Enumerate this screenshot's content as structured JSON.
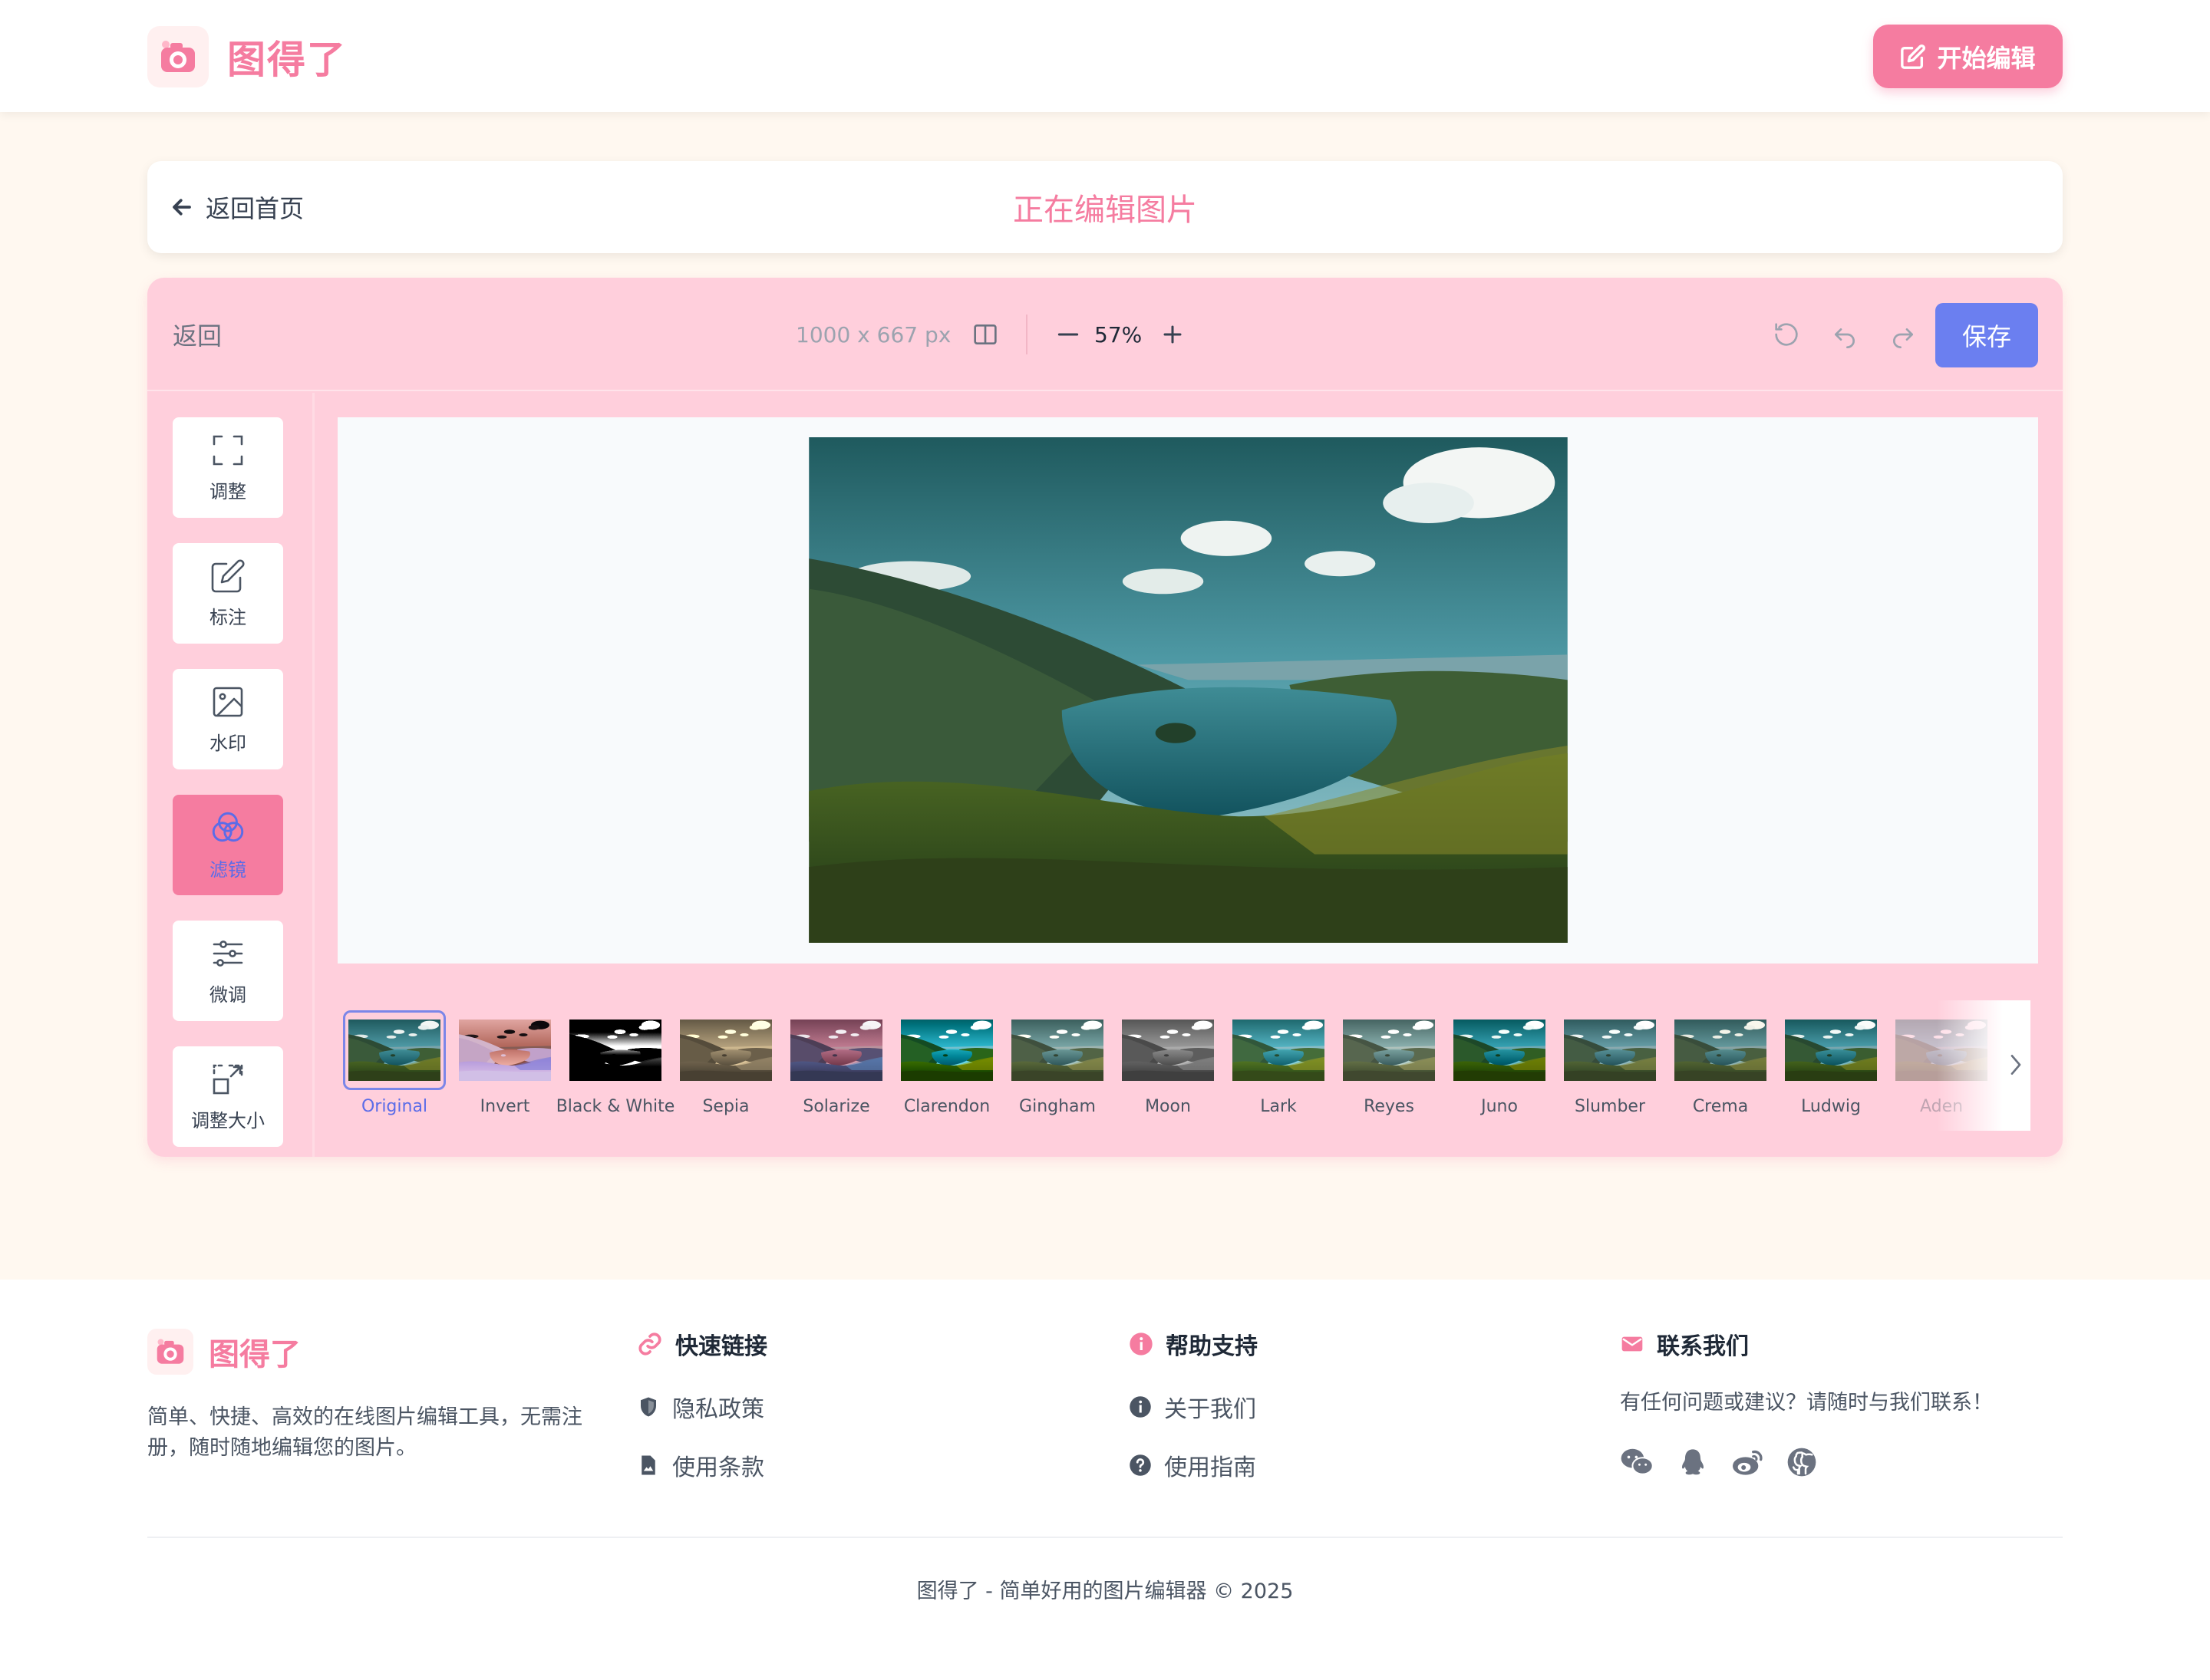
{
  "header": {
    "app_name": "图得了",
    "start_edit_label": "开始编辑"
  },
  "titlebar": {
    "back_home_label": "返回首页",
    "title": "正在编辑图片"
  },
  "toolbar": {
    "back_label": "返回",
    "image_size": "1000 x 667 px",
    "zoom": "57%",
    "save_label": "保存"
  },
  "tools": [
    {
      "label": "调整",
      "icon": "crop-frame-icon",
      "active": false
    },
    {
      "label": "标注",
      "icon": "pen-edit-icon",
      "active": false
    },
    {
      "label": "水印",
      "icon": "image-icon",
      "active": false
    },
    {
      "label": "滤镜",
      "icon": "filter-circles-icon",
      "active": true
    },
    {
      "label": "微调",
      "icon": "sliders-icon",
      "active": false
    },
    {
      "label": "调整大小",
      "icon": "resize-icon",
      "active": false
    }
  ],
  "filters": [
    {
      "name": "Original",
      "active": true
    },
    {
      "name": "Invert"
    },
    {
      "name": "Black & White"
    },
    {
      "name": "Sepia"
    },
    {
      "name": "Solarize"
    },
    {
      "name": "Clarendon"
    },
    {
      "name": "Gingham"
    },
    {
      "name": "Moon"
    },
    {
      "name": "Lark"
    },
    {
      "name": "Reyes"
    },
    {
      "name": "Juno"
    },
    {
      "name": "Slumber"
    },
    {
      "name": "Crema"
    },
    {
      "name": "Ludwig"
    },
    {
      "name": "Aden",
      "faded": true
    }
  ],
  "footer": {
    "app_name": "图得了",
    "description": "简单、快捷、高效的在线图片编辑工具，无需注册，随时随地编辑您的图片。",
    "quick_links_title": "快速链接",
    "privacy_label": "隐私政策",
    "terms_label": "使用条款",
    "help_title": "帮助支持",
    "about_label": "关于我们",
    "guide_label": "使用指南",
    "contact_title": "联系我们",
    "contact_text": "有任何问题或建议？请随时与我们联系！",
    "copyright": "图得了 - 简单好用的图片编辑器 © 2025"
  },
  "colors": {
    "brand": "#f57ca0",
    "editor_bg": "#ffcfdc",
    "save_button": "#6b7ff0",
    "page_bg": "#fff8f0"
  }
}
